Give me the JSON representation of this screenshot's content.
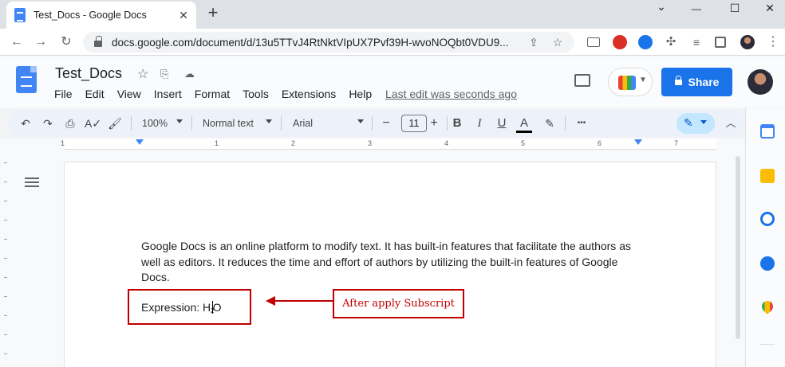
{
  "browser": {
    "tab_title": "Test_Docs - Google Docs",
    "tab_close": "✕",
    "new_tab": "+",
    "url": "docs.google.com/document/d/13u5TTvJ4RtNktVIpUX7Pvf39H-wvoNOQbt0VDU9..."
  },
  "doc": {
    "title": "Test_Docs",
    "menu": [
      "File",
      "Edit",
      "View",
      "Insert",
      "Format",
      "Tools",
      "Extensions",
      "Help"
    ],
    "last_edit": "Last edit was seconds ago",
    "share_label": "Share"
  },
  "toolbar": {
    "zoom": "100%",
    "style": "Normal text",
    "font": "Arial",
    "font_size": "11",
    "minus": "−",
    "plus": "+",
    "bold": "B",
    "italic": "I",
    "underline": "U",
    "text_color": "A",
    "more": "•••"
  },
  "ruler": {
    "numbers": [
      "1",
      "1",
      "2",
      "3",
      "4",
      "5",
      "6",
      "7"
    ]
  },
  "content": {
    "paragraph": "Google Docs is an online platform to modify text. It has built-in features that facilitate the authors as well as editors. It reduces the time and effort of authors by utilizing the built-in features of Google Docs.",
    "expression_prefix": "Expression: H",
    "expression_sub": "2",
    "expression_suffix": "O"
  },
  "annotation": {
    "callout": "After apply Subscript",
    "color": "#c00000"
  },
  "colors": {
    "share": "#1a73e8",
    "docs_blue": "#4285f4",
    "annotation_red": "#c00000"
  }
}
